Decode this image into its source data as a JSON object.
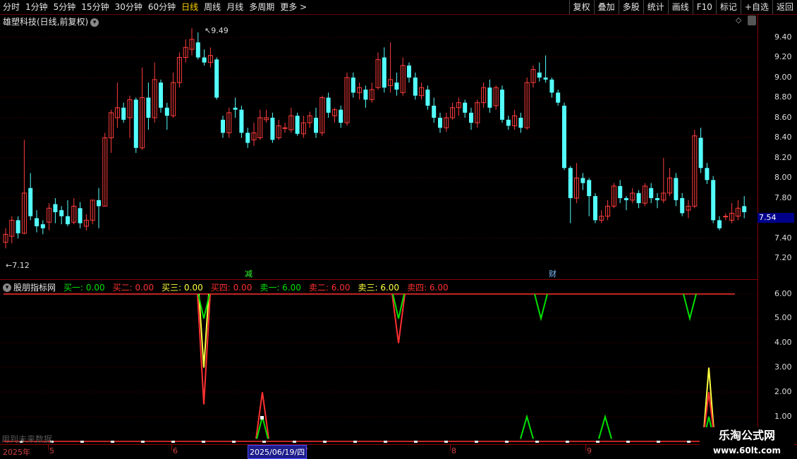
{
  "toolbar": {
    "periods": [
      "分时",
      "1分钟",
      "5分钟",
      "15分钟",
      "30分钟",
      "60分钟",
      "日线",
      "周线",
      "月线",
      "多周期",
      "更多 >"
    ],
    "active_index": 6,
    "right_buttons": [
      "复权",
      "叠加",
      "多股",
      "统计",
      "画线",
      "F10",
      "标记",
      "+自选",
      "返回"
    ]
  },
  "chart_title": "雄塑科技(日线,前复权)",
  "price_axis": [
    "9.40",
    "9.20",
    "9.00",
    "8.80",
    "8.60",
    "8.40",
    "8.20",
    "8.00",
    "7.80",
    "7.40",
    "7.20"
  ],
  "current_price": "7.54",
  "high_label": "9.49",
  "low_label": "7.12",
  "event_markers": {
    "reduce": "减",
    "finance": "财"
  },
  "indicator": {
    "name": "股朋指标网",
    "legend": [
      {
        "label": "买一: 0.00",
        "color": "#00e000"
      },
      {
        "label": "买二: 0.00",
        "color": "#ff3030"
      },
      {
        "label": "买三: 0.00",
        "color": "#ffff40"
      },
      {
        "label": "买四: 0.00",
        "color": "#ff3030"
      },
      {
        "label": "卖一: 6.00",
        "color": "#00e000"
      },
      {
        "label": "卖二: 6.00",
        "color": "#ff3030"
      },
      {
        "label": "卖三: 6.00",
        "color": "#ffff40"
      },
      {
        "label": "卖四: 6.00",
        "color": "#ff3030"
      }
    ],
    "axis": [
      "6.00",
      "5.00",
      "4.00",
      "3.00",
      "2.00",
      "1.00"
    ],
    "ghost_text": "用到未来数据"
  },
  "dates": {
    "year": "2025年",
    "months": [
      "5",
      "6",
      "7",
      "8",
      "9"
    ],
    "cursor": "2025/06/19/四"
  },
  "watermark": {
    "line1": "乐淘公式网",
    "line2": "www.60lt.com"
  },
  "colors": {
    "up": "#ff3c3c",
    "down": "#54ffff",
    "grid": "#8b0000"
  }
}
